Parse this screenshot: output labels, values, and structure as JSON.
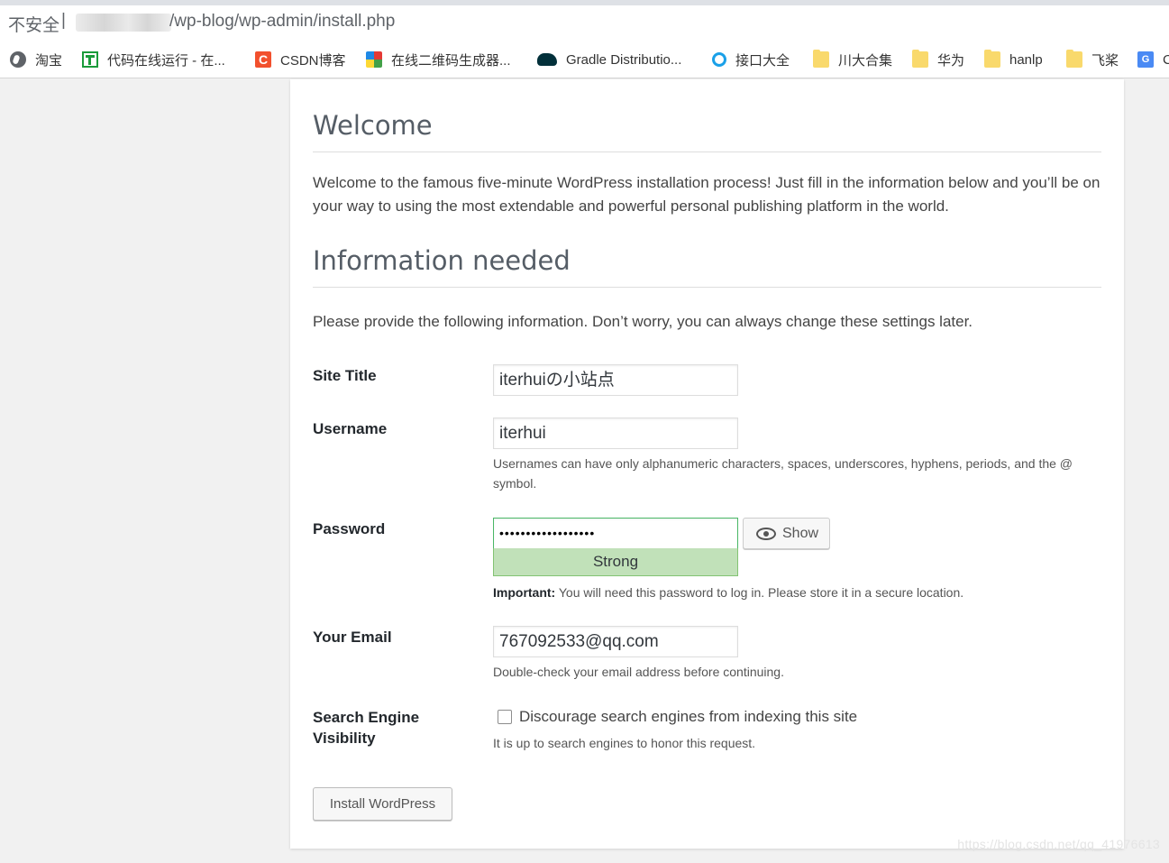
{
  "browser": {
    "address": {
      "insecure_label": "不安全",
      "separator": "|",
      "path": "/wp-blog/wp-admin/install.php"
    },
    "bookmarks": [
      {
        "label": "淘宝",
        "icon": "globe-icon"
      },
      {
        "label": "代码在线运行 - 在...",
        "icon": "tool-icon"
      },
      {
        "label": "CSDN博客",
        "icon": "csdn-icon"
      },
      {
        "label": "在线二维码生成器...",
        "icon": "qrcode-icon"
      },
      {
        "label": "Gradle Distributio...",
        "icon": "gradle-icon"
      },
      {
        "label": "接口大全",
        "icon": "api-icon"
      },
      {
        "label": "川大合集",
        "icon": "folder-icon"
      },
      {
        "label": "华为",
        "icon": "folder-icon"
      },
      {
        "label": "hanlp",
        "icon": "folder-icon"
      },
      {
        "label": "飞桨",
        "icon": "folder-icon"
      },
      {
        "label": "C",
        "icon": "translate-icon"
      }
    ]
  },
  "page": {
    "welcome_title": "Welcome",
    "welcome_text": "Welcome to the famous five-minute WordPress installation process! Just fill in the information below and you’ll be on your way to using the most extendable and powerful personal publishing platform in the world.",
    "info_title": "Information needed",
    "info_text": "Please provide the following information. Don’t worry, you can always change these settings later.",
    "form": {
      "site_title_label": "Site Title",
      "site_title_value": "iterhuiの小站点",
      "username_label": "Username",
      "username_value": "iterhui",
      "username_hint": "Usernames can have only alphanumeric characters, spaces, underscores, hyphens, periods, and the @ symbol.",
      "password_label": "Password",
      "password_value": "••••••••••••••••••",
      "show_label": "Show",
      "strength": "Strong",
      "password_hint_strong": "Important:",
      "password_hint": " You will need this password to log in. Please store it in a secure location.",
      "email_label": "Your Email",
      "email_value": "767092533@qq.com",
      "email_hint": "Double-check your email address before continuing.",
      "visibility_label_1": "Search Engine",
      "visibility_label_2": "Visibility",
      "visibility_checkbox": "Discourage search engines from indexing this site",
      "visibility_checked": false,
      "visibility_hint": "It is up to search engines to honor this request.",
      "install_button": "Install WordPress"
    }
  },
  "watermark": "https://blog.csdn.net/qq_41976613",
  "colors": {
    "strength_bg": "#c1e1b9",
    "strength_border": "#83c373",
    "page_bg": "#f1f1f1"
  }
}
